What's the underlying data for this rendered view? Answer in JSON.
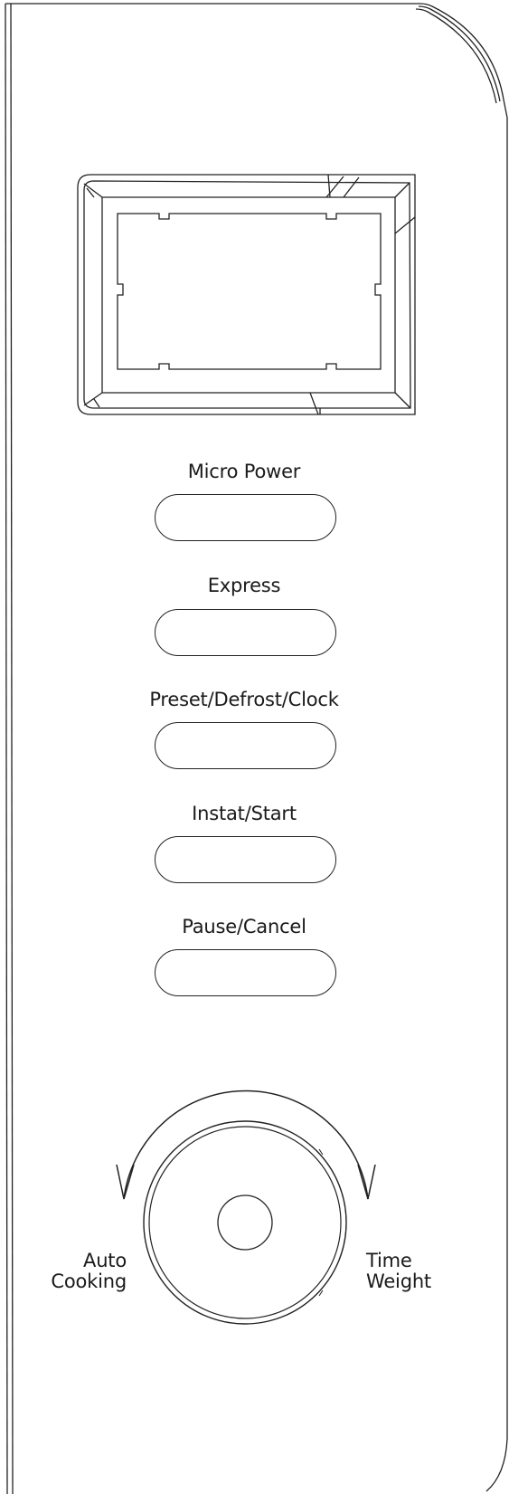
{
  "panel": {
    "display": {
      "reading": ""
    },
    "buttons": [
      {
        "id": "micro-power",
        "label": "Micro Power"
      },
      {
        "id": "express",
        "label": "Express"
      },
      {
        "id": "preset-defrost-clock",
        "label": "Preset/Defrost/Clock"
      },
      {
        "id": "instat-start",
        "label": "Instat/Start"
      },
      {
        "id": "pause-cancel",
        "label": "Pause/Cancel"
      }
    ],
    "dial": {
      "left_label_line1": "Auto",
      "left_label_line2": "Cooking",
      "right_label_line1": "Time",
      "right_label_line2": "Weight"
    }
  },
  "colors": {
    "line": "#222222",
    "background": "#ffffff",
    "text": "#1a1a1a"
  }
}
